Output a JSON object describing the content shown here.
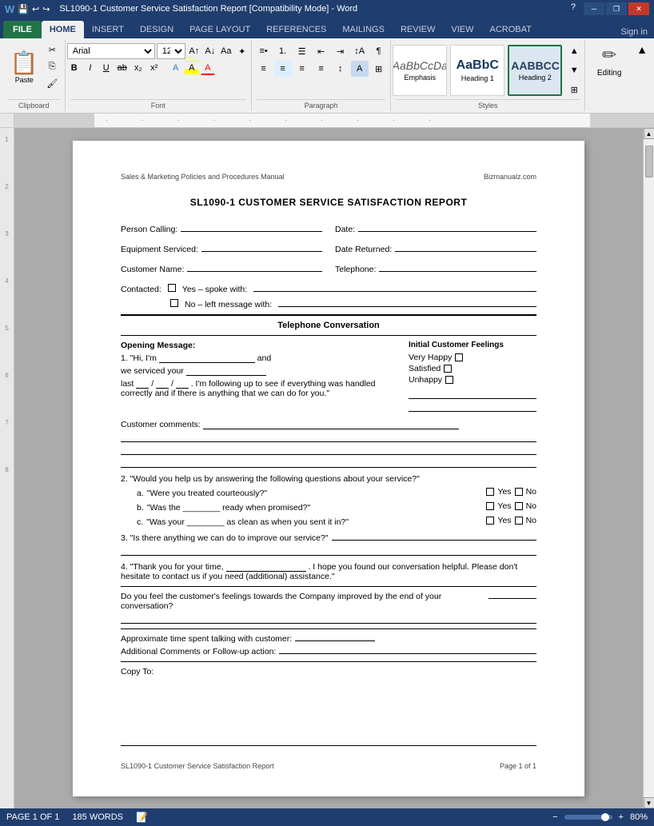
{
  "titlebar": {
    "title": "SL1090-1 Customer Service Satisfaction Report [Compatibility Mode] - Word",
    "help_icon": "?",
    "minimize": "─",
    "restore": "❐",
    "close": "✕",
    "app_icons": [
      "◼",
      "💾",
      "↩"
    ]
  },
  "ribbon": {
    "tabs": [
      "FILE",
      "HOME",
      "INSERT",
      "DESIGN",
      "PAGE LAYOUT",
      "REFERENCES",
      "MAILINGS",
      "REVIEW",
      "VIEW",
      "ACROBAT"
    ],
    "active_tab": "HOME",
    "clipboard": {
      "label": "Clipboard",
      "paste_label": "Paste"
    },
    "font": {
      "label": "Font",
      "font_name": "Arial",
      "font_size": "12",
      "bold": "B",
      "italic": "I",
      "underline": "U"
    },
    "paragraph": {
      "label": "Paragraph"
    },
    "styles": {
      "label": "Styles",
      "items": [
        {
          "name": "Emphasis",
          "preview": "AaBbCcDa",
          "type": "emphasis"
        },
        {
          "name": "Heading 1",
          "preview": "AaBbC",
          "type": "heading1"
        },
        {
          "name": "Heading 2",
          "preview": "AABBCC",
          "type": "heading2"
        }
      ]
    },
    "editing": {
      "label": "Editing"
    }
  },
  "document": {
    "header_left": "Sales & Marketing Policies and Procedures Manual",
    "header_right": "Bizmanualz.com",
    "title": "SL1090-1 CUSTOMER SERVICE SATISFACTION REPORT",
    "fields": {
      "person_calling": "Person Calling:",
      "date": "Date:",
      "equipment_serviced": "Equipment Serviced:",
      "date_returned": "Date Returned:",
      "customer_name": "Customer Name:",
      "telephone": "Telephone:"
    },
    "contacted": {
      "label": "Contacted:",
      "option1": "Yes – spoke with:",
      "option2": "No – left message with:"
    },
    "telephone_section": "Telephone Conversation",
    "opening_message_label": "Opening Message:",
    "opening_message_text": "1. \"Hi, I'm",
    "opening_message_and": "and",
    "opening_message_cont": "we serviced your",
    "opening_message_last": "last",
    "opening_message_rest": ". I'm following up to see if everything was handled correctly and if there is anything that we can do for you.\"",
    "initial_feelings_label": "Initial Customer Feelings",
    "feelings": [
      {
        "label": "Very Happy"
      },
      {
        "label": "Satisfied"
      },
      {
        "label": "Unhappy"
      }
    ],
    "customer_comments": "Customer comments:",
    "question2": "2. \"Would you help us by answering the following questions about your service?\"",
    "sub_questions": [
      {
        "letter": "a.",
        "text": "\"Were you treated courteously?\""
      },
      {
        "letter": "b.",
        "text": "\"Was the ________ ready when promised?\""
      },
      {
        "letter": "c.",
        "text": "\"Was your ________ as clean as when you sent it in?\""
      }
    ],
    "question3_label": "3. \"Is there anything we can do to improve our service?\"",
    "question4_label": "4. \"Thank you for your time,",
    "question4_rest": ". I hope you found our conversation helpful. Please don't hesitate to contact us if you need (additional) assistance.\"",
    "feelings_question": "Do you feel the customer's feelings towards the Company improved by the end of your conversation?",
    "approximate_time": "Approximate time spent talking with customer:",
    "additional_comments": "Additional Comments or Follow-up action:",
    "copy_to": "Copy To:",
    "footer_left": "SL1090-1 Customer Service Satisfaction Report",
    "footer_right": "Page 1 of 1"
  },
  "statusbar": {
    "page_info": "PAGE 1 OF 1",
    "word_count": "185 WORDS",
    "zoom": "80%"
  }
}
